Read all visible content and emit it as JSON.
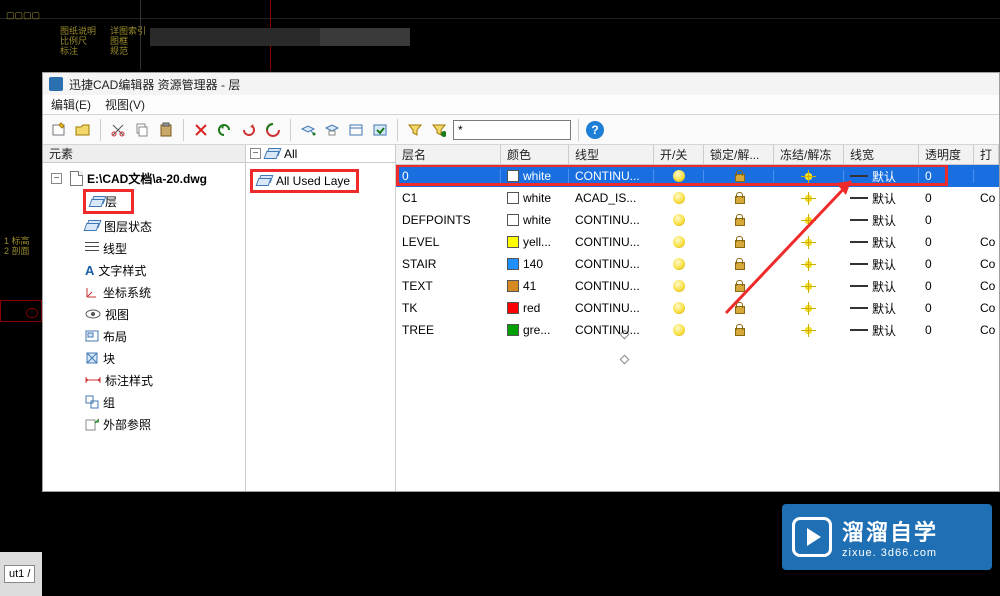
{
  "background": {
    "texts": [
      "图纸",
      "标注",
      "剖面",
      "详图"
    ]
  },
  "panel": {
    "title": "迅捷CAD编辑器 资源管理器 - 层",
    "menus": {
      "edit": "编辑(E)",
      "view": "视图(V)"
    },
    "toolbar": {
      "filter_value": "*"
    },
    "leftpane": {
      "header": "元素",
      "root": "E:\\CAD文档\\a-20.dwg",
      "items": [
        {
          "label": "层",
          "highlighted": true
        },
        {
          "label": "图层状态"
        },
        {
          "label": "线型"
        },
        {
          "label": "文字样式"
        },
        {
          "label": "坐标系统"
        },
        {
          "label": "视图"
        },
        {
          "label": "布局"
        },
        {
          "label": "块"
        },
        {
          "label": "标注样式"
        },
        {
          "label": "组"
        },
        {
          "label": "外部参照"
        }
      ]
    },
    "midpane": {
      "all": "All",
      "all_used": "All Used Laye"
    },
    "grid": {
      "cols": {
        "name": "层名",
        "color": "颜色",
        "linetype": "线型",
        "onoff": "开/关",
        "lock": "锁定/解...",
        "freeze": "冻结/解冻",
        "lineweight": "线宽",
        "transparency": "透明度",
        "plot": "打"
      },
      "default_lw": "默认",
      "rows": [
        {
          "name": "0",
          "color_name": "white",
          "swatch": "#ffffff",
          "linetype": "CONTINU...",
          "lw": "默认",
          "tr": "0",
          "pl": "",
          "selected": true
        },
        {
          "name": "C1",
          "color_name": "white",
          "swatch": "#ffffff",
          "linetype": "ACAD_IS...",
          "lw": "默认",
          "tr": "0",
          "pl": "Co"
        },
        {
          "name": "DEFPOINTS",
          "color_name": "white",
          "swatch": "#ffffff",
          "linetype": "CONTINU...",
          "lw": "默认",
          "tr": "0",
          "pl": ""
        },
        {
          "name": "LEVEL",
          "color_name": "yell...",
          "swatch": "#ffff00",
          "linetype": "CONTINU...",
          "lw": "默认",
          "tr": "0",
          "pl": "Co"
        },
        {
          "name": "STAIR",
          "color_name": "140",
          "swatch": "#1e90ff",
          "linetype": "CONTINU...",
          "lw": "默认",
          "tr": "0",
          "pl": "Co"
        },
        {
          "name": "TEXT",
          "color_name": "41",
          "swatch": "#d48a1f",
          "linetype": "CONTINU...",
          "lw": "默认",
          "tr": "0",
          "pl": "Co"
        },
        {
          "name": "TK",
          "color_name": "red",
          "swatch": "#ff0000",
          "linetype": "CONTINU...",
          "lw": "默认",
          "tr": "0",
          "pl": "Co"
        },
        {
          "name": "TREE",
          "color_name": "gre...",
          "swatch": "#00a000",
          "linetype": "CONTINU...",
          "lw": "默认",
          "tr": "0",
          "pl": "Co"
        }
      ]
    }
  },
  "bottombar": {
    "tab": "ut1 /"
  },
  "watermark": {
    "big": "溜溜自学",
    "small": "zixue. 3d66.com"
  }
}
